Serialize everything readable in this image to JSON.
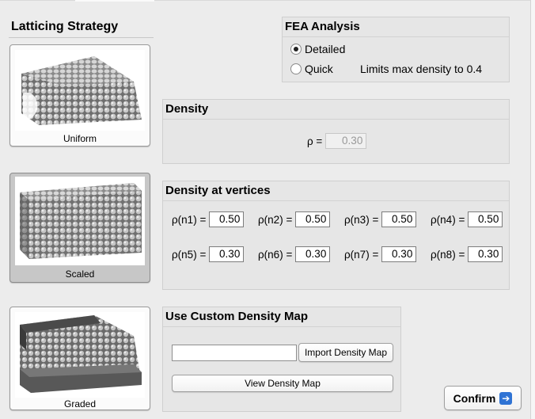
{
  "strategy": {
    "title": "Latticing Strategy",
    "options": [
      {
        "label": "Uniform",
        "selected": false
      },
      {
        "label": "Scaled",
        "selected": true
      },
      {
        "label": "Graded",
        "selected": false
      }
    ]
  },
  "fea": {
    "title": "FEA Analysis",
    "detailed_label": "Detailed",
    "quick_label": "Quick",
    "quick_note": "Limits max density to 0.4",
    "selected": "Detailed"
  },
  "density": {
    "title": "Density",
    "label": "ρ =",
    "value": "0.30"
  },
  "vertices": {
    "title": "Density at vertices",
    "items": [
      {
        "label": "ρ(n1) =",
        "value": "0.50"
      },
      {
        "label": "ρ(n2) =",
        "value": "0.50"
      },
      {
        "label": "ρ(n3) =",
        "value": "0.50"
      },
      {
        "label": "ρ(n4) =",
        "value": "0.50"
      },
      {
        "label": "ρ(n5) =",
        "value": "0.30"
      },
      {
        "label": "ρ(n6) =",
        "value": "0.30"
      },
      {
        "label": "ρ(n7) =",
        "value": "0.30"
      },
      {
        "label": "ρ(n8) =",
        "value": "0.30"
      }
    ]
  },
  "custom_map": {
    "title": "Use Custom Density Map",
    "path_value": "",
    "import_label": "Import Density Map",
    "view_label": "View Density Map"
  },
  "confirm_label": "Confirm",
  "icons": {
    "confirm": "arrow-right-icon",
    "radio": "radio-button-icon"
  },
  "colors": {
    "selected_card": "#c7c7c7",
    "confirm_arrow": "#2f73d4",
    "lattice": "#a8a8a8"
  }
}
